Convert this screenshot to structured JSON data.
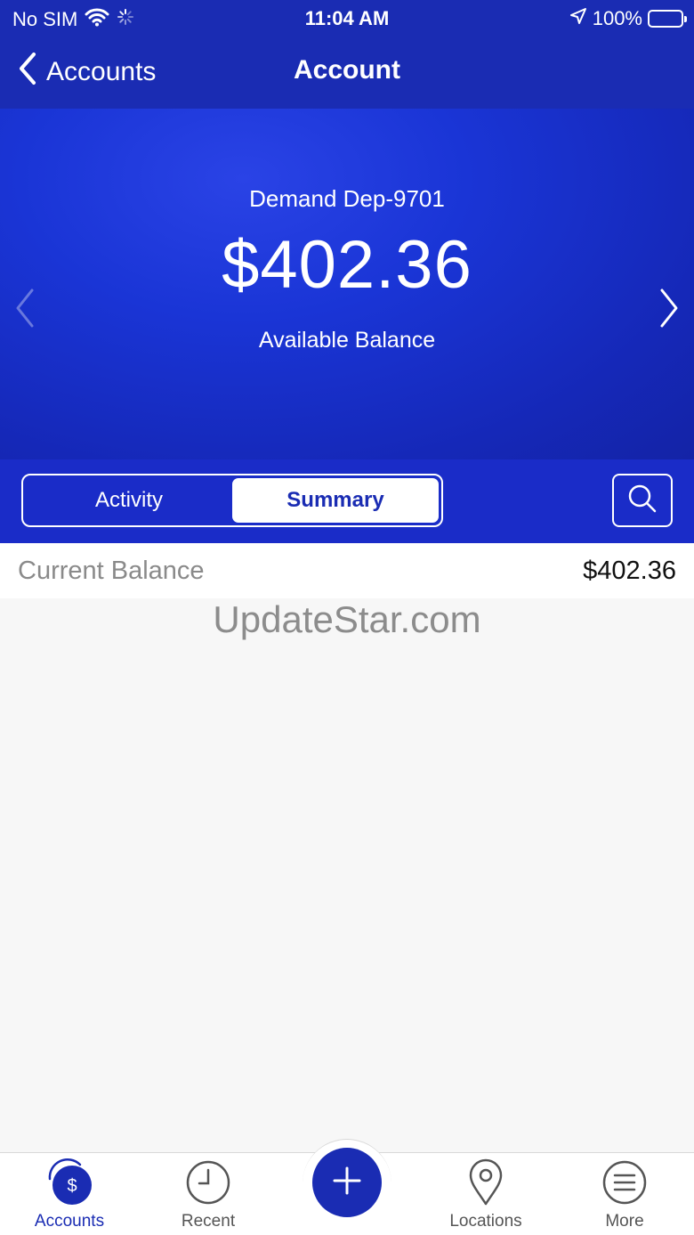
{
  "status_bar": {
    "carrier": "No SIM",
    "time": "11:04 AM",
    "battery": "100%"
  },
  "nav": {
    "back_label": "Accounts",
    "title": "Account"
  },
  "account": {
    "name": "Demand Dep-9701",
    "balance": "$402.36",
    "balance_label": "Available Balance"
  },
  "segments": {
    "activity": "Activity",
    "summary": "Summary",
    "selected": "Summary"
  },
  "summary": {
    "rows": [
      {
        "label": "Current Balance",
        "value": "$402.36"
      }
    ]
  },
  "watermark": "UpdateStar.com",
  "tabbar": {
    "items": [
      {
        "label": "Accounts",
        "icon": "dollar-coin-icon",
        "active": true
      },
      {
        "label": "Recent",
        "icon": "clock-icon",
        "active": false
      },
      {
        "label": "",
        "icon": "plus-icon",
        "active": false
      },
      {
        "label": "Locations",
        "icon": "map-pin-icon",
        "active": false
      },
      {
        "label": "More",
        "icon": "menu-icon",
        "active": false
      }
    ]
  },
  "colors": {
    "brand": "#1a2cb3",
    "hero": "#1a35d6",
    "battery_fill": "#4cd964"
  }
}
